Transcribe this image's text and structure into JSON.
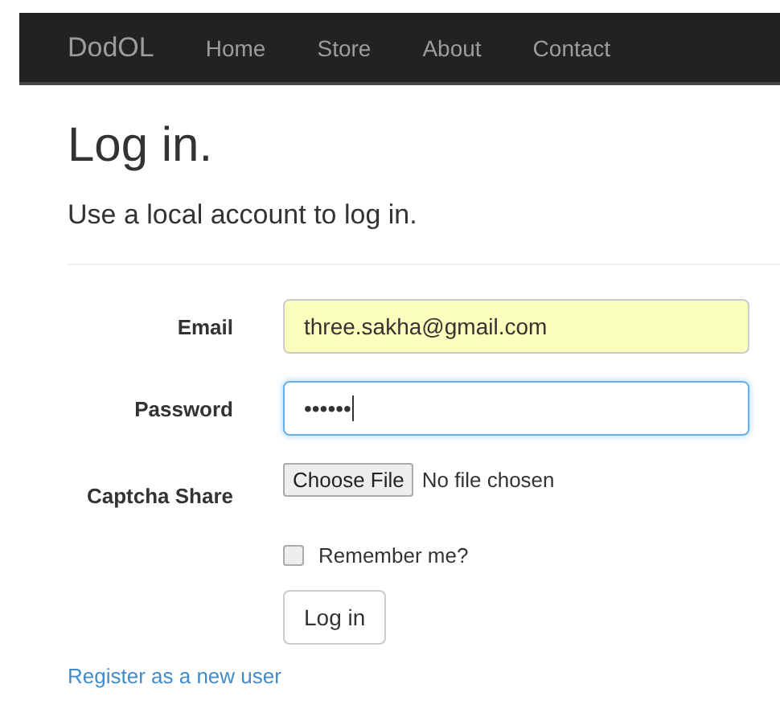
{
  "navbar": {
    "brand": "DodOL",
    "links": [
      "Home",
      "Store",
      "About",
      "Contact"
    ]
  },
  "title": "Log in.",
  "subtitle": "Use a local account to log in.",
  "fields": [
    {
      "kind": "text",
      "label": "Email",
      "value": "three.sakha@gmail.com",
      "autofilled": true,
      "focused": false
    },
    {
      "kind": "text",
      "label": "Password",
      "value": "••••••",
      "autofilled": false,
      "focused": true
    },
    {
      "kind": "file",
      "label": "Captcha Share",
      "button": "Choose File",
      "status": "No file chosen"
    }
  ],
  "remember": {
    "label": "Remember me?",
    "checked": false
  },
  "submit": "Log in",
  "register_link": "Register as a new user"
}
